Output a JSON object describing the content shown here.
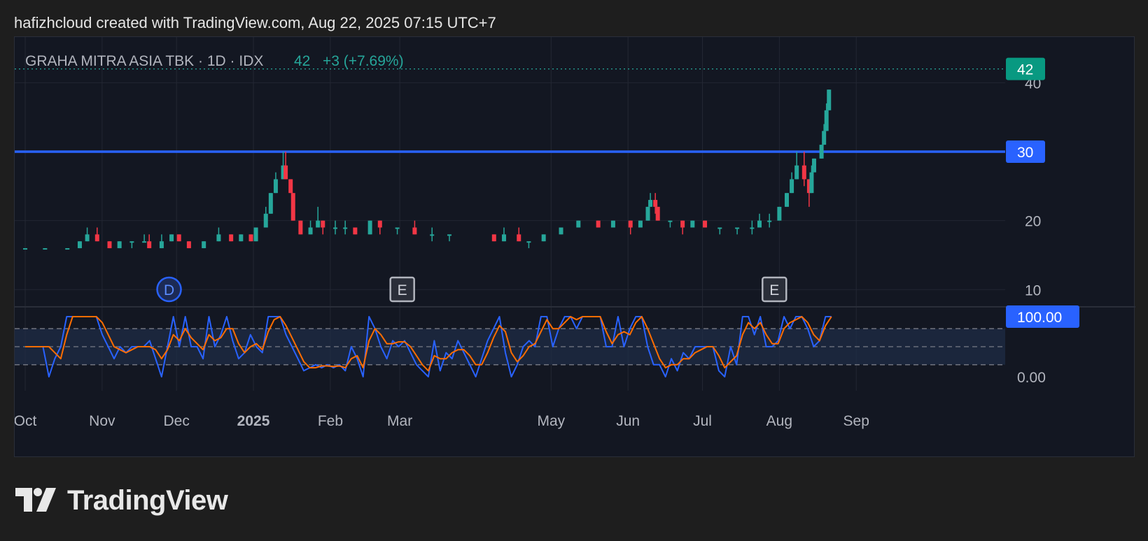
{
  "header": {
    "attribution": "hafizhcloud created with TradingView.com, Aug 22, 2025 07:15 UTC+7"
  },
  "legend": {
    "symbol": "GRAHA MITRA ASIA TBK · 1D · IDX",
    "last": "42",
    "change": "+3 (+7.69%)"
  },
  "brand": {
    "name": "TradingView",
    "logo_icon": "tradingview-logo-icon"
  },
  "colors": {
    "up": "#26a69a",
    "down": "#f23645",
    "blue_line": "#2962ff",
    "stoch_k": "#2962ff",
    "stoch_d": "#ff6d00",
    "band": "#1f2d47",
    "grid": "#232733",
    "axis_text": "#b2b5be"
  },
  "chart_data": [
    {
      "type": "candlestick",
      "title": "GRAHA MITRA ASIA TBK · 1D · IDX",
      "y_ticks": [
        "40",
        "30",
        "20",
        "10"
      ],
      "ylim": [
        8,
        45
      ],
      "x_ticks": [
        "Oct",
        "Nov",
        "Dec",
        "2025",
        "Feb",
        "Mar",
        "May",
        "Jun",
        "Jul",
        "Aug",
        "Sep"
      ],
      "x_range": [
        "2024-10-01",
        "2025-09-30"
      ],
      "last_price_label": "42",
      "horizontal_line": {
        "value": 30,
        "label": "30"
      },
      "event_markers": [
        {
          "label": "D",
          "date": "2024-11-28",
          "kind": "dividend"
        },
        {
          "label": "E",
          "date": "2025-03-02",
          "kind": "earnings"
        },
        {
          "label": "E",
          "date": "2025-07-30",
          "kind": "earnings"
        }
      ],
      "candles": [
        [
          "2024-10-01",
          16,
          16,
          16,
          16
        ],
        [
          "2024-10-09",
          16,
          16,
          16,
          16
        ],
        [
          "2024-10-18",
          16,
          16,
          16,
          16
        ],
        [
          "2024-10-23",
          16,
          17,
          16,
          17
        ],
        [
          "2024-10-26",
          17,
          19,
          17,
          18
        ],
        [
          "2024-10-30",
          18,
          19,
          17,
          17
        ],
        [
          "2024-11-04",
          17,
          17,
          16,
          16
        ],
        [
          "2024-11-08",
          16,
          17,
          16,
          17
        ],
        [
          "2024-11-13",
          17,
          17,
          16,
          17
        ],
        [
          "2024-11-18",
          17,
          18,
          17,
          17
        ],
        [
          "2024-11-20",
          17,
          18,
          16,
          16
        ],
        [
          "2024-11-25",
          16,
          18,
          16,
          17
        ],
        [
          "2024-11-29",
          17,
          18,
          17,
          18
        ],
        [
          "2024-12-02",
          18,
          18,
          17,
          17
        ],
        [
          "2024-12-06",
          17,
          17,
          16,
          16
        ],
        [
          "2024-12-12",
          16,
          17,
          16,
          17
        ],
        [
          "2024-12-18",
          17,
          19,
          17,
          18
        ],
        [
          "2024-12-23",
          18,
          18,
          17,
          17
        ],
        [
          "2024-12-27",
          17,
          18,
          17,
          18
        ],
        [
          "2024-12-31",
          18,
          18,
          17,
          17
        ],
        [
          "2025-01-02",
          17,
          19,
          17,
          19
        ],
        [
          "2025-01-06",
          19,
          22,
          19,
          21
        ],
        [
          "2025-01-08",
          21,
          24,
          21,
          24
        ],
        [
          "2025-01-10",
          24,
          27,
          24,
          26
        ],
        [
          "2025-01-13",
          26,
          30,
          26,
          28
        ],
        [
          "2025-01-14",
          28,
          30,
          26,
          26
        ],
        [
          "2025-01-16",
          26,
          26,
          24,
          24
        ],
        [
          "2025-01-17",
          24,
          24,
          20,
          20
        ],
        [
          "2025-01-20",
          20,
          20,
          18,
          18
        ],
        [
          "2025-01-24",
          18,
          20,
          18,
          19
        ],
        [
          "2025-01-27",
          19,
          22,
          19,
          20
        ],
        [
          "2025-01-29",
          20,
          20,
          18,
          19
        ],
        [
          "2025-02-03",
          19,
          20,
          18,
          19
        ],
        [
          "2025-02-07",
          19,
          20,
          18,
          19
        ],
        [
          "2025-02-11",
          19,
          19,
          18,
          18
        ],
        [
          "2025-02-17",
          18,
          20,
          18,
          20
        ],
        [
          "2025-02-21",
          20,
          20,
          18,
          19
        ],
        [
          "2025-02-28",
          19,
          19,
          18,
          19
        ],
        [
          "2025-03-07",
          19,
          20,
          18,
          18
        ],
        [
          "2025-03-14",
          18,
          19,
          17,
          18
        ],
        [
          "2025-03-21",
          18,
          18,
          17,
          18
        ],
        [
          "2025-04-08",
          18,
          18,
          17,
          17
        ],
        [
          "2025-04-12",
          17,
          19,
          17,
          18
        ],
        [
          "2025-04-18",
          18,
          19,
          17,
          17
        ],
        [
          "2025-04-22",
          17,
          17,
          16,
          17
        ],
        [
          "2025-04-28",
          17,
          18,
          17,
          18
        ],
        [
          "2025-05-05",
          18,
          19,
          18,
          19
        ],
        [
          "2025-05-12",
          19,
          20,
          19,
          20
        ],
        [
          "2025-05-20",
          20,
          20,
          19,
          19
        ],
        [
          "2025-05-26",
          19,
          20,
          19,
          20
        ],
        [
          "2025-06-02",
          20,
          20,
          18,
          19
        ],
        [
          "2025-06-06",
          19,
          20,
          19,
          20
        ],
        [
          "2025-06-09",
          20,
          22,
          20,
          22
        ],
        [
          "2025-06-10",
          22,
          24,
          22,
          23
        ],
        [
          "2025-06-12",
          23,
          24,
          21,
          22
        ],
        [
          "2025-06-13",
          22,
          22,
          20,
          20
        ],
        [
          "2025-06-18",
          20,
          20,
          19,
          20
        ],
        [
          "2025-06-23",
          20,
          20,
          18,
          19
        ],
        [
          "2025-06-27",
          19,
          20,
          19,
          20
        ],
        [
          "2025-07-02",
          20,
          20,
          19,
          19
        ],
        [
          "2025-07-08",
          19,
          19,
          18,
          19
        ],
        [
          "2025-07-15",
          19,
          19,
          18,
          19
        ],
        [
          "2025-07-21",
          19,
          20,
          18,
          19
        ],
        [
          "2025-07-24",
          19,
          21,
          19,
          20
        ],
        [
          "2025-07-28",
          20,
          21,
          19,
          20
        ],
        [
          "2025-08-01",
          20,
          22,
          20,
          22
        ],
        [
          "2025-08-04",
          22,
          24,
          22,
          24
        ],
        [
          "2025-08-06",
          24,
          27,
          24,
          26
        ],
        [
          "2025-08-08",
          26,
          30,
          26,
          28
        ],
        [
          "2025-08-11",
          28,
          30,
          25,
          26
        ],
        [
          "2025-08-13",
          26,
          26,
          22,
          24
        ],
        [
          "2025-08-14",
          24,
          28,
          24,
          27
        ],
        [
          "2025-08-15",
          27,
          29,
          27,
          29
        ],
        [
          "2025-08-18",
          29,
          31,
          29,
          31
        ],
        [
          "2025-08-19",
          31,
          34,
          31,
          33
        ],
        [
          "2025-08-20",
          33,
          37,
          33,
          36
        ],
        [
          "2025-08-21",
          36,
          39,
          36,
          39
        ]
      ]
    },
    {
      "type": "line",
      "title": "",
      "series": [
        {
          "name": "",
          "color": "#2962ff",
          "values": [
            50,
            50,
            50,
            50,
            0,
            30,
            50,
            100,
            100,
            100,
            100,
            100,
            100,
            70,
            50,
            30,
            50,
            40,
            50,
            50,
            50,
            60,
            30,
            0,
            50,
            100,
            50,
            100,
            50,
            50,
            30,
            100,
            50,
            70,
            100,
            60,
            30,
            40,
            70,
            50,
            40,
            100,
            100,
            100,
            70,
            50,
            30,
            10,
            15,
            20,
            15,
            20,
            15,
            20,
            10,
            50,
            30,
            0,
            100,
            80,
            50,
            30,
            60,
            50,
            60,
            40,
            20,
            10,
            0,
            60,
            10,
            40,
            30,
            60,
            40,
            20,
            0,
            30,
            60,
            80,
            100,
            40,
            0,
            20,
            50,
            60,
            50,
            100,
            100,
            50,
            80,
            100,
            100,
            80,
            100,
            100,
            100,
            100,
            50,
            50,
            100,
            50,
            80,
            100,
            100,
            50,
            20,
            20,
            0,
            30,
            10,
            40,
            30,
            50,
            50,
            50,
            50,
            10,
            0,
            50,
            20,
            100,
            100,
            70,
            100,
            50,
            50,
            60,
            100,
            80,
            100,
            100,
            80,
            50,
            60,
            100,
            100
          ]
        },
        {
          "name": "",
          "color": "#ff6d00",
          "values": [
            50,
            50,
            50,
            50,
            50,
            40,
            30,
            70,
            100,
            100,
            100,
            100,
            100,
            90,
            70,
            50,
            45,
            40,
            45,
            50,
            50,
            50,
            45,
            30,
            45,
            70,
            60,
            80,
            65,
            55,
            45,
            70,
            60,
            65,
            80,
            80,
            55,
            40,
            50,
            55,
            45,
            75,
            95,
            100,
            85,
            65,
            45,
            25,
            15,
            15,
            18,
            18,
            17,
            18,
            15,
            30,
            35,
            15,
            60,
            80,
            70,
            55,
            55,
            58,
            58,
            50,
            35,
            20,
            10,
            35,
            30,
            30,
            40,
            45,
            45,
            35,
            20,
            20,
            40,
            65,
            85,
            75,
            40,
            25,
            35,
            50,
            55,
            75,
            95,
            80,
            80,
            90,
            100,
            95,
            100,
            100,
            100,
            100,
            75,
            55,
            70,
            75,
            70,
            90,
            100,
            80,
            55,
            30,
            15,
            20,
            20,
            30,
            30,
            40,
            45,
            50,
            50,
            35,
            15,
            25,
            35,
            70,
            90,
            80,
            90,
            70,
            55,
            55,
            80,
            90,
            95,
            100,
            90,
            70,
            60,
            85,
            100
          ]
        }
      ],
      "x_range": [
        "2024-10-01",
        "2025-08-22"
      ],
      "y_ticks": [
        "100.00",
        "0.00"
      ],
      "ylim": [
        0,
        100
      ],
      "bands": [
        20,
        50,
        80
      ],
      "last_value_label": "100.00"
    }
  ]
}
